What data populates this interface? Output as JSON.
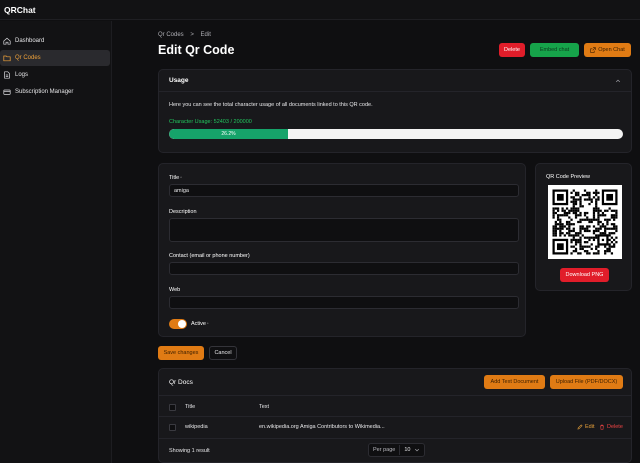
{
  "app": {
    "title": "QRChat"
  },
  "sidebar": {
    "items": [
      {
        "label": "Dashboard",
        "icon": "home-icon"
      },
      {
        "label": "Qr Codes",
        "icon": "folder-icon"
      },
      {
        "label": "Logs",
        "icon": "document-icon"
      },
      {
        "label": "Subscription Manager",
        "icon": "credit-card-icon"
      }
    ]
  },
  "breadcrumb": {
    "parent": "Qr Codes",
    "separator": ">",
    "current": "Edit"
  },
  "header": {
    "title": "Edit Qr Code",
    "delete_label": "Delete",
    "embed_label": "Embed chat",
    "open_chat_label": "Open Chat"
  },
  "usage": {
    "title": "Usage",
    "description": "Here you can see the total character usage of all documents linked to this QR code.",
    "character_usage_label": "Character Usage: 52403 / 200000",
    "progress_percent": 26.2,
    "progress_label": "26.2%"
  },
  "form": {
    "title_label": "Title",
    "title_value": "amiga",
    "description_label": "Description",
    "description_value": "",
    "contact_label": "Contact (email or phone number)",
    "contact_value": "",
    "web_label": "Web",
    "web_value": "",
    "active_label": "Active",
    "active": true,
    "required_marker": "*"
  },
  "qr_preview": {
    "title": "QR Code Preview",
    "download_label": "Download PNG"
  },
  "actions": {
    "save_label": "Save changes",
    "cancel_label": "Cancel"
  },
  "docs": {
    "title": "Qr Docs",
    "add_text_label": "Add Text Document",
    "upload_label": "Upload File (PDF/DOCX)",
    "columns": [
      "Title",
      "Text"
    ],
    "rows": [
      {
        "title": "wikipedia",
        "text": "en.wikipedia.org Amiga Contributors to Wikimedia...",
        "edit_label": "Edit",
        "delete_label": "Delete"
      }
    ],
    "showing": "Showing 1 result",
    "per_page_label": "Per page",
    "per_page_value": "10"
  },
  "colors": {
    "accent": "#e07b14",
    "danger": "#e11d2a",
    "success": "#16a34a",
    "progress": "#16a36a"
  }
}
